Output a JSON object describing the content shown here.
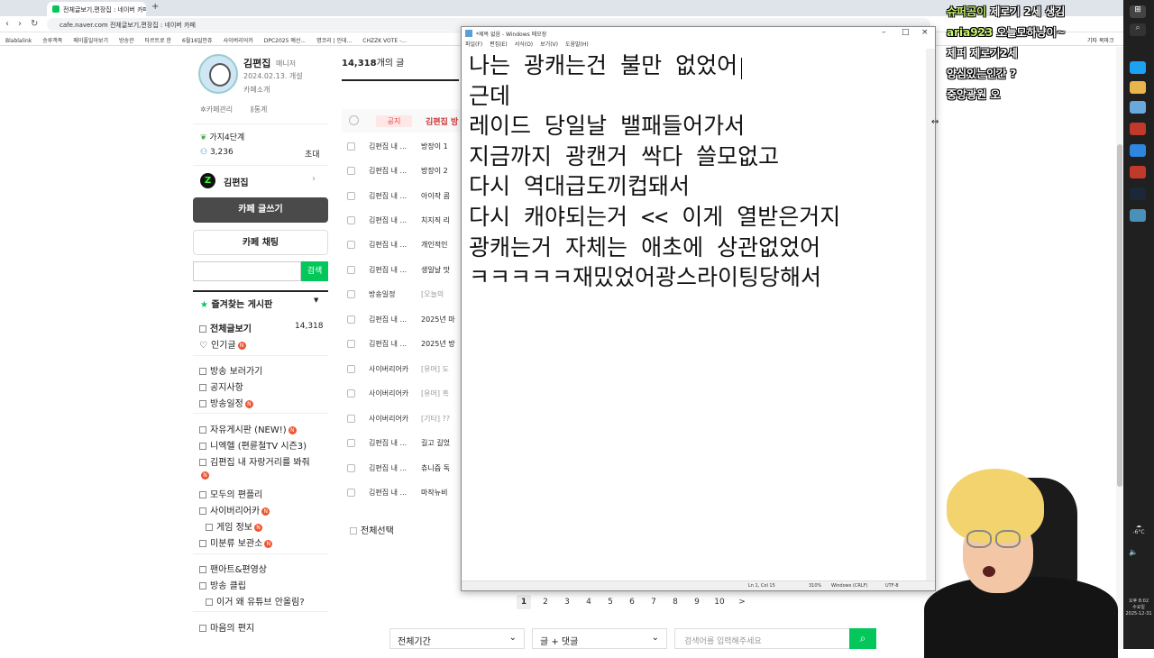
{
  "browser": {
    "tab_title": "전체글보기,편장집 : 네이버 카페",
    "new_tab_icon": "plus-icon",
    "url": "cafe.naver.com 전체글보기,편장집 : 네이버 카페",
    "bookmarks": [
      "Blablalink",
      "승루객족",
      "메이플일아보기",
      "방송관",
      "타르트로 한",
      "6월16일안쥬",
      "사이버리어카",
      "DPC2025 예선...",
      "명코리 | 인데...",
      "CHZZK VOTE -..."
    ],
    "bookmarks_right": "기타 북마크"
  },
  "cafe": {
    "manager_name": "김편집",
    "manager_role": "매니저",
    "founded": "2024.02.13. 개설",
    "intro_link": "카페소개",
    "manage_link": "카페관리",
    "stats_link": "통계",
    "level": "가지4단계",
    "members": "3,236",
    "invite": "초대",
    "channel_name": "김편집",
    "write_button": "카페 글쓰기",
    "chat_button": "카페 채팅",
    "search_button": "검색",
    "favorites_header": "즐겨찾는 게시판",
    "menu": [
      {
        "label": "전체글보기",
        "count": "14,318",
        "bold": true
      },
      {
        "label": "인기글",
        "badge": true
      },
      {
        "label": "방송 보러가기"
      },
      {
        "label": "공지사항"
      },
      {
        "label": "방송일정",
        "badge": true
      },
      {
        "label": "자유게시판 (NEW!)",
        "badge": true
      },
      {
        "label": "니엑헬 (편륜철TV 시즌3)"
      },
      {
        "label": "김편집 내 자랑거리를 봐줘",
        "badge": true
      },
      {
        "label": "모두의 편플리"
      },
      {
        "label": "사이버리어카",
        "badge": true
      },
      {
        "label": "게임 정보",
        "badge": true,
        "indent": true
      },
      {
        "label": "미분류 보관소",
        "badge": true
      },
      {
        "label": "팬아트&편영상"
      },
      {
        "label": "방송 클립"
      },
      {
        "label": "이거 왜 유튜브 안올림?",
        "indent": true
      },
      {
        "label": "마음의 편지"
      }
    ]
  },
  "list": {
    "total_count": "14,318",
    "count_suffix": "개의 글",
    "notice_badge": "공지",
    "notice_title": "김편집 방",
    "rows": [
      {
        "author": "김편집 내 ...",
        "title": "방장이 1"
      },
      {
        "author": "김편집 내 ...",
        "title": "방장이 2"
      },
      {
        "author": "김편집 내 ...",
        "title": "아이작 콤"
      },
      {
        "author": "김편집 내 ...",
        "title": "치지직 리"
      },
      {
        "author": "김편집 내 ...",
        "title": "개인적인"
      },
      {
        "author": "김편집 내 ...",
        "title": "생일날 맛"
      },
      {
        "author": "방송일정",
        "title": "[오늘의"
      },
      {
        "author": "김편집 내 ...",
        "title": "2025년 마"
      },
      {
        "author": "김편집 내 ...",
        "title": "2025년 방"
      },
      {
        "author": "사이버리어카",
        "title": "[유머] 도"
      },
      {
        "author": "사이버리어카",
        "title": "[유머] 흑"
      },
      {
        "author": "사이버리어카",
        "title": "[기타] ??"
      },
      {
        "author": "김편집 내 ...",
        "title": "길고 길었"
      },
      {
        "author": "김편집 내 ...",
        "title": "츄니즘 독"
      },
      {
        "author": "김편집 내 ...",
        "title": "마작뉴비"
      }
    ],
    "select_all": "전체선택",
    "pages": [
      "1",
      "2",
      "3",
      "4",
      "5",
      "6",
      "7",
      "8",
      "9",
      "10",
      ">"
    ],
    "current_page": "1",
    "period_select": "전체기간",
    "scope_select": "글 + 댓글",
    "search_placeholder": "검색어를 입력해주세요"
  },
  "notepad": {
    "title": "*제목 없음 - Windows 메모장",
    "menu": [
      "파일(F)",
      "편집(E)",
      "서식(O)",
      "보기(V)",
      "도움말(H)"
    ],
    "lines": [
      "나는 광캐는건 불만 없었어",
      "근데",
      "레이드 당일날 밸패들어가서",
      "지금까지 광캔거 싹다 쓸모없고",
      "다시 역대급도끼컵돼서",
      "다시 캐야되는거 << 이게 열받은거지",
      "광캐는거 자체는 애초에 상관없었어",
      "ㅋㅋㅋㅋㅋ재밌었어광스라이팅당해서"
    ],
    "status": {
      "position": "Ln 1, Col 15",
      "zoom": "310%",
      "eol": "Windows (CRLF)",
      "encoding": "UTF-8"
    }
  },
  "chat": [
    {
      "nick": "슈퍼곰이",
      "msg": "제로기 2세 생김"
    },
    {
      "nick": "aria923",
      "msg": "오늘모하냥이~"
    },
    {
      "nick": "",
      "msg": "제퍼 제로기2세"
    },
    {
      "nick": "",
      "msg": "양심있는인간 ?"
    },
    {
      "nick": "",
      "msg": "중앙광원 오"
    }
  ],
  "taskbar": {
    "weather": "-6°C",
    "time": "오후 8:02",
    "day": "수요일",
    "date": "2025-12-31"
  },
  "colors": {
    "naver_green": "#03c75a",
    "write_button": "#4a4a4a",
    "badge_red": "#e53",
    "chat_nick": "#c8f56e"
  }
}
